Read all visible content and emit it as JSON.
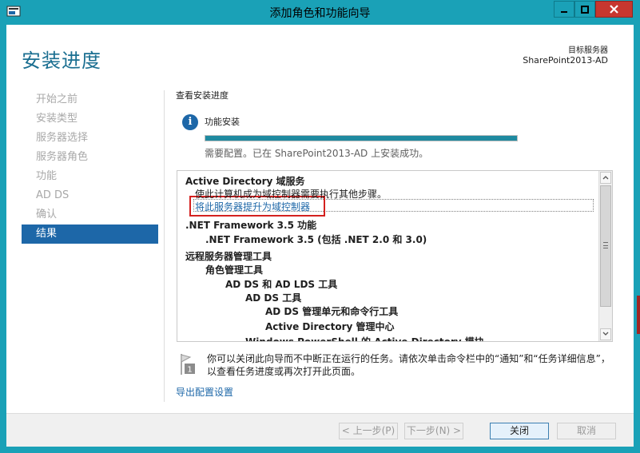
{
  "window": {
    "title": "添加角色和功能向导",
    "accent_color": "#1aa1b7",
    "close_color": "#c7372f"
  },
  "header": {
    "title": "安装进度",
    "target_label": "目标服务器",
    "target_name": "SharePoint2013-AD"
  },
  "nav": {
    "items": [
      {
        "label": "开始之前",
        "active": false
      },
      {
        "label": "安装类型",
        "active": false
      },
      {
        "label": "服务器选择",
        "active": false
      },
      {
        "label": "服务器角色",
        "active": false
      },
      {
        "label": "功能",
        "active": false
      },
      {
        "label": "AD DS",
        "active": false
      },
      {
        "label": "确认",
        "active": false
      },
      {
        "label": "结果",
        "active": true
      }
    ],
    "active_color": "#1d67a8"
  },
  "main": {
    "section_title": "查看安装进度",
    "feature_install_label": "功能安装",
    "progress_percent": 100,
    "status_text": "需要配置。已在 SharePoint2013-AD 上安装成功。",
    "results": [
      {
        "text": "Active Directory 域服务",
        "bold": true,
        "indent": 0
      },
      {
        "text": "使此计算机成为域控制器需要执行其他步骤。",
        "bold": false,
        "indent": 1
      },
      {
        "text": "将此服务器提升为域控制器",
        "link": true,
        "indent": 1
      },
      {
        "text": ".NET Framework 3.5 功能",
        "bold": true,
        "indent": 0
      },
      {
        "text": ".NET Framework 3.5 (包括 .NET 2.0 和 3.0)",
        "bold": true,
        "indent": 1
      },
      {
        "text": "远程服务器管理工具",
        "bold": true,
        "indent": 0
      },
      {
        "text": "角色管理工具",
        "bold": true,
        "indent": 1
      },
      {
        "text": "AD DS 和 AD LDS 工具",
        "bold": true,
        "indent": 2
      },
      {
        "text": "AD DS 工具",
        "bold": true,
        "indent": 3
      },
      {
        "text": "AD DS 管理单元和命令行工具",
        "bold": true,
        "indent": 4
      },
      {
        "text": "Active Directory 管理中心",
        "bold": true,
        "indent": 4
      },
      {
        "text": "Windows PowerShell 的 Active Directory 模块",
        "bold": true,
        "indent": 3
      }
    ],
    "note_text": "你可以关闭此向导而不中断正在运行的任务。请依次单击命令栏中的“通知”和“任务详细信息”，以查看任务进度或再次打开此页面。",
    "note_badge": "1",
    "export_link": "导出配置设置"
  },
  "footer": {
    "prev_label": "< 上一步(P)",
    "next_label": "下一步(N) >",
    "close_label": "关闭",
    "cancel_label": "取消"
  }
}
